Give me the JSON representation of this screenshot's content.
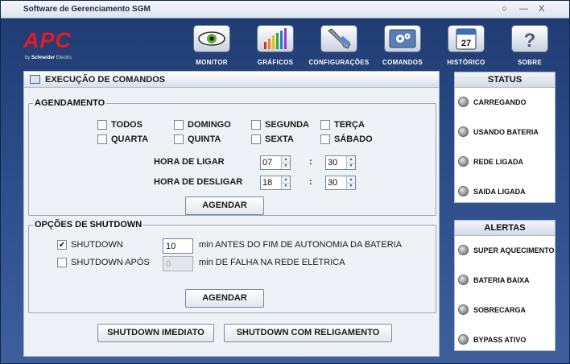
{
  "window": {
    "title": "Software de Gerenciamento SGM",
    "controls": [
      "○",
      "—",
      "X"
    ]
  },
  "brand": {
    "logo": "APC",
    "sub_prefix": "by ",
    "sub_brand": "Schneider",
    "sub_suffix": " Electric"
  },
  "toolbar": [
    {
      "label": "MONITOR",
      "icon": "eye-icon"
    },
    {
      "label": "GRÁFICOS",
      "icon": "bar-chart-icon"
    },
    {
      "label": "CONFIGURAÇÕES",
      "icon": "wrench-icon"
    },
    {
      "label": "COMANDOS",
      "icon": "gears-icon"
    },
    {
      "label": "HISTÓRICO",
      "icon": "calendar-icon",
      "calendar_day": "27"
    },
    {
      "label": "SOBRE",
      "icon": "help-icon",
      "glyph": "?"
    }
  ],
  "panel": {
    "title": "EXECUÇÃO DE COMANDOS",
    "schedule": {
      "legend": "AGENDAMENTO",
      "days": [
        {
          "label": "TODOS",
          "checked": false
        },
        {
          "label": "DOMINGO",
          "checked": false
        },
        {
          "label": "SEGUNDA",
          "checked": false
        },
        {
          "label": "TERÇA",
          "checked": false
        },
        {
          "label": "QUARTA",
          "checked": false
        },
        {
          "label": "QUINTA",
          "checked": false
        },
        {
          "label": "SEXTA",
          "checked": false
        },
        {
          "label": "SÁBADO",
          "checked": false
        }
      ],
      "on_label": "HORA DE LIGAR",
      "on_hour": "07",
      "on_minute": "30",
      "off_label": "HORA DE DESLIGAR",
      "off_hour": "18",
      "off_minute": "30",
      "separator": ":",
      "button": "AGENDAR"
    },
    "shutdown": {
      "legend": "OPÇÕES DE SHUTDOWN",
      "opt1_label": "SHUTDOWN",
      "opt1_checked": true,
      "opt1_value": "10",
      "opt1_suffix": "min ANTES DO FIM DE AUTONOMIA DA BATERIA",
      "opt2_label": "SHUTDOWN APÓS",
      "opt2_checked": false,
      "opt2_value": "0",
      "opt2_suffix": "min DE FALHA NA REDE ELÉTRICA",
      "button": "AGENDAR"
    },
    "actions": {
      "immediate": "SHUTDOWN IMEDIATO",
      "restart": "SHUTDOWN COM RELIGAMENTO"
    }
  },
  "status": {
    "title": "STATUS",
    "items": [
      "CARREGANDO",
      "USANDO BATERIA",
      "REDE LIGADA",
      "SAIDA LIGADA"
    ]
  },
  "alerts": {
    "title": "ALERTAS",
    "items": [
      "SUPER AQUECIMENTO",
      "BATERIA BAIXA",
      "SOBRECARGA",
      "BYPASS ATIVO"
    ]
  },
  "colors": {
    "brand_red": "#e01b24",
    "header_blue": "#1f3a70",
    "led_off": "#9a9a9a"
  }
}
